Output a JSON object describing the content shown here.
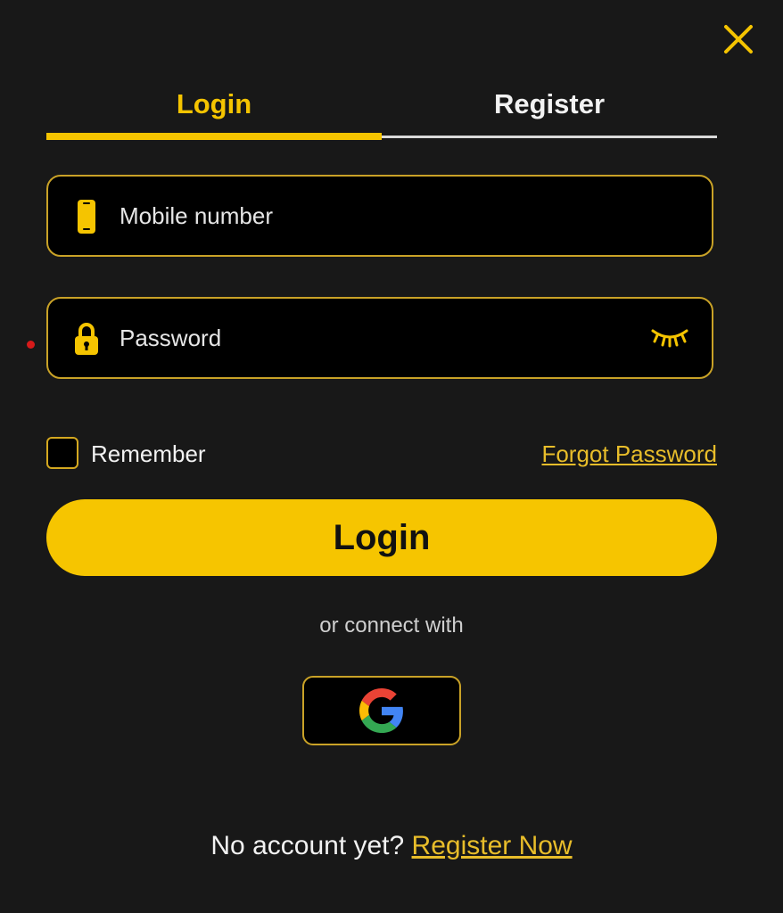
{
  "colors": {
    "accent": "#f5c400",
    "background": "#181818",
    "field_border": "#c9a227",
    "link": "#e8bd2a"
  },
  "header": {
    "close_icon": "close-icon"
  },
  "tabs": [
    {
      "label": "Login",
      "active": true
    },
    {
      "label": "Register",
      "active": false
    }
  ],
  "form": {
    "mobile": {
      "placeholder": "Mobile number",
      "value": "",
      "icon": "phone-icon"
    },
    "password": {
      "placeholder": "Password",
      "value": "",
      "icon": "lock-icon",
      "toggle_icon": "eye-closed-icon"
    },
    "remember_label": "Remember",
    "remember_checked": false,
    "forgot_label": "Forgot Password",
    "submit_label": "Login"
  },
  "social": {
    "connect_text": "or connect with",
    "google_icon": "google-icon"
  },
  "footer": {
    "question": "No account yet?",
    "register_link": "Register Now"
  }
}
